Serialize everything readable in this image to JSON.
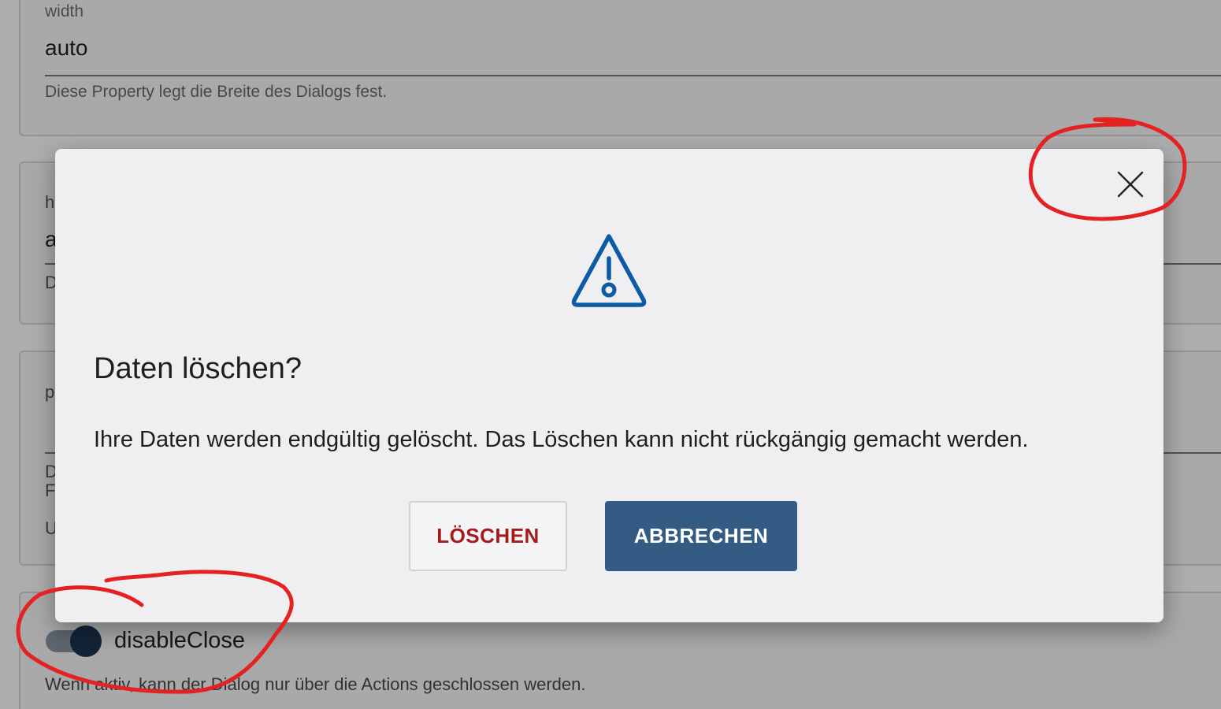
{
  "background": {
    "fields": [
      {
        "label": "width",
        "value": "auto",
        "help": "Diese Property legt die Breite des Dialogs fest."
      }
    ],
    "partial_chars": [
      "h",
      "a",
      "D",
      "p",
      "D",
      "F",
      "U"
    ],
    "toggle": {
      "label": "disableClose",
      "checked": true,
      "help": "Wenn aktiv, kann der Dialog nur über die Actions geschlossen werden."
    }
  },
  "dialog": {
    "title": "Daten löschen?",
    "text": "Ihre Daten werden endgültig gelöscht. Das Löschen kann nicht rückgängig gemacht werden.",
    "icon": "warning-triangle-icon",
    "close_icon": "close-icon",
    "buttons": {
      "delete_label": "LÖSCHEN",
      "cancel_label": "ABBRECHEN"
    }
  },
  "colors": {
    "primary": "#345b83",
    "danger": "#a51b1b",
    "icon": "#0d5aa7",
    "annotation": "#e52222"
  }
}
